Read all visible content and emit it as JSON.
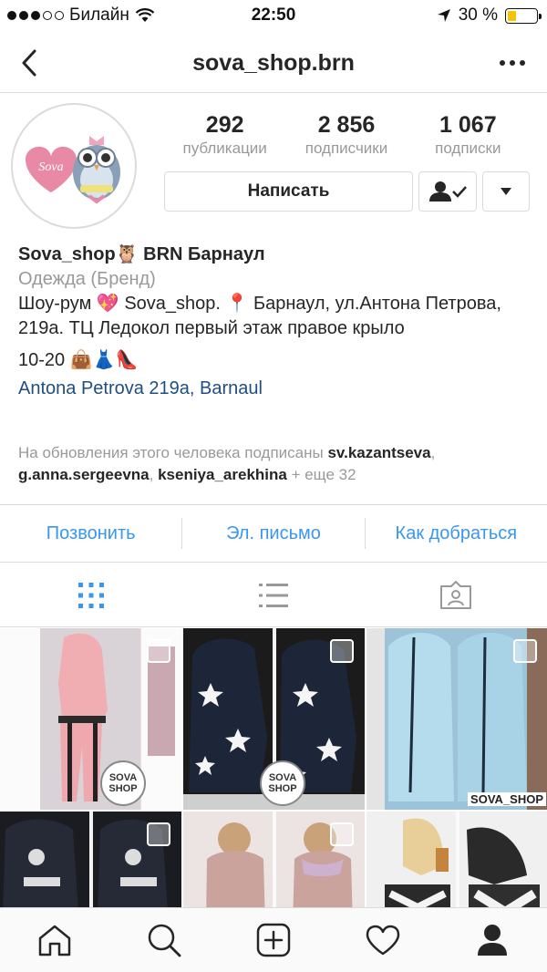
{
  "status_bar": {
    "carrier": "Билайн",
    "time": "22:50",
    "battery": "30 %",
    "battery_level": 0.3
  },
  "navbar": {
    "title": "sova_shop.brn"
  },
  "profile": {
    "avatar_text": "Sova",
    "stats": [
      {
        "value": "292",
        "label": "публикации"
      },
      {
        "value": "2 856",
        "label": "подписчики"
      },
      {
        "value": "1 067",
        "label": "подписки"
      }
    ],
    "message_button": "Написать"
  },
  "bio": {
    "name": "Sova_shop🦉 BRN Барнаул",
    "category": "Одежда (Бренд)",
    "description": "Шоу-рум 💖 Sova_shop. 📍 Барнаул, ул.Антона Петрова, 219а. ТЦ Ледокол первый этаж правое крыло",
    "hours": "10-20 👜👗👠",
    "location": "Antona Petrova 219a, Barnaul",
    "followed_prefix": "На обновления этого человека подписаны ",
    "followed_user1": "sv.kazantseva",
    "followed_sep1": ", ",
    "followed_user2": "g.anna.sergeevna",
    "followed_sep2": ", ",
    "followed_user3": "kseniya_arekhina",
    "followed_more": " + еще 32"
  },
  "contacts": {
    "call": "Позвонить",
    "email": "Эл. письмо",
    "directions": "Как добраться"
  },
  "tabs": [
    "grid-view",
    "list-view",
    "tagged"
  ],
  "grid": {
    "badge_text": "SOVA SHOP",
    "tag_text": "SOVA_SHOP"
  },
  "colors": {
    "link": "#3897f0",
    "location": "#1f4e85",
    "muted": "#999999",
    "active_tab": "#3897f0"
  }
}
